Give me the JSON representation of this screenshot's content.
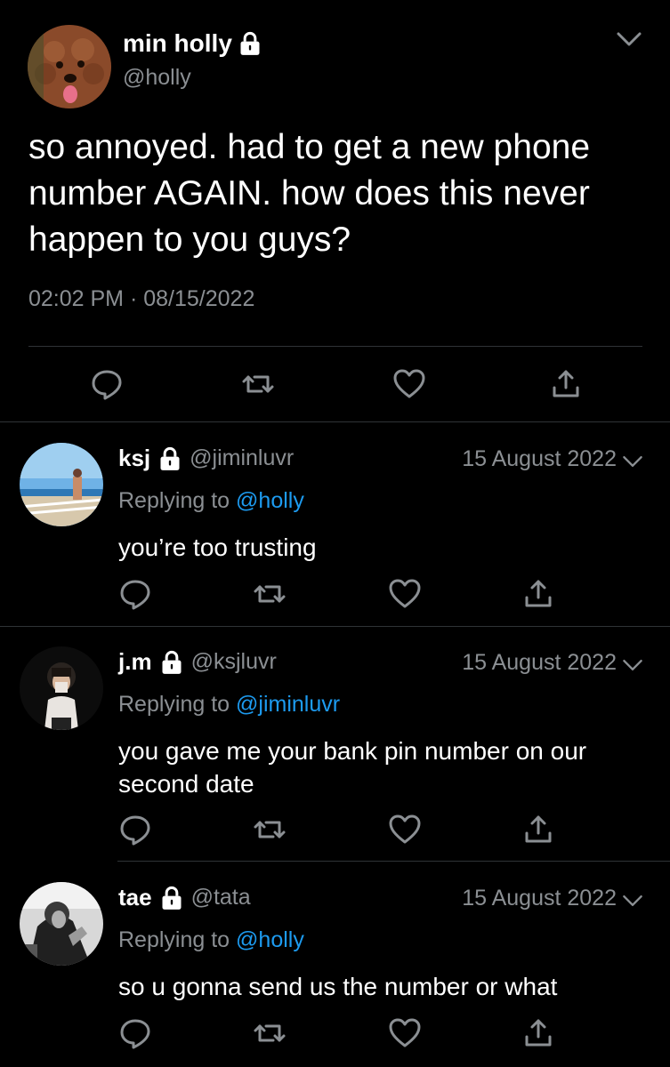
{
  "main_tweet": {
    "display_name": "min holly",
    "handle": "@holly",
    "text": "so annoyed. had to get a new phone number AGAIN. how does this never happen to you guys?",
    "timestamp": "02:02 PM · 08/15/2022"
  },
  "replies": [
    {
      "display_name": "ksj",
      "handle": "@jiminluvr",
      "date": "15 August 2022",
      "replying_prefix": "Replying to",
      "replying_to": "@holly",
      "text": "you’re too trusting"
    },
    {
      "display_name": "j.m",
      "handle": "@ksjluvr",
      "date": "15 August 2022",
      "replying_prefix": "Replying to",
      "replying_to": "@jiminluvr",
      "text": "you gave me your bank pin number on our second date"
    },
    {
      "display_name": "tae",
      "handle": "@tata",
      "date": "15 August 2022",
      "replying_prefix": "Replying to",
      "replying_to": "@holly",
      "text": "so u gonna send us the number or what"
    }
  ],
  "icons": {
    "reply": "reply-icon",
    "retweet": "retweet-icon",
    "like": "like-icon",
    "share": "share-icon",
    "lock": "lock-icon",
    "more": "chevron-down-icon"
  },
  "colors": {
    "background": "#000000",
    "text": "#ffffff",
    "muted": "#8b8f93",
    "link": "#1d9bf0",
    "divider": "#2f3336"
  }
}
